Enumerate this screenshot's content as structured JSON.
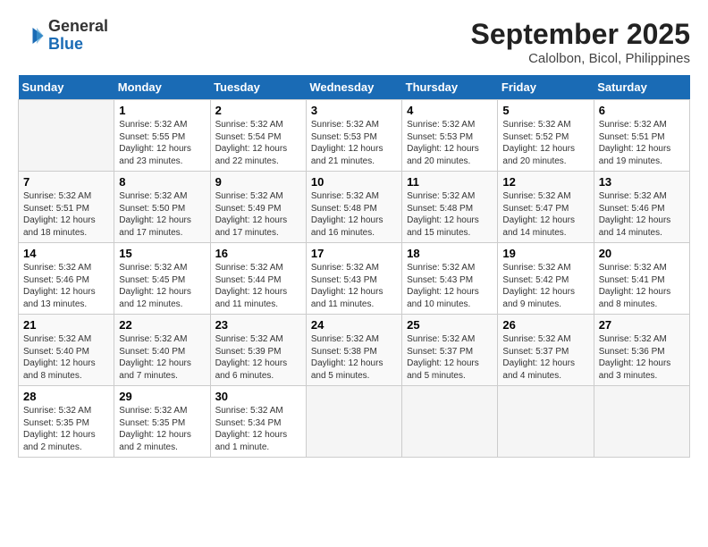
{
  "header": {
    "logo": {
      "general": "General",
      "blue": "Blue"
    },
    "month_year": "September 2025",
    "location": "Calolbon, Bicol, Philippines"
  },
  "weekdays": [
    "Sunday",
    "Monday",
    "Tuesday",
    "Wednesday",
    "Thursday",
    "Friday",
    "Saturday"
  ],
  "weeks": [
    [
      {
        "day": null
      },
      {
        "day": 1,
        "sunrise": "5:32 AM",
        "sunset": "5:55 PM",
        "daylight": "12 hours and 23 minutes."
      },
      {
        "day": 2,
        "sunrise": "5:32 AM",
        "sunset": "5:54 PM",
        "daylight": "12 hours and 22 minutes."
      },
      {
        "day": 3,
        "sunrise": "5:32 AM",
        "sunset": "5:53 PM",
        "daylight": "12 hours and 21 minutes."
      },
      {
        "day": 4,
        "sunrise": "5:32 AM",
        "sunset": "5:53 PM",
        "daylight": "12 hours and 20 minutes."
      },
      {
        "day": 5,
        "sunrise": "5:32 AM",
        "sunset": "5:52 PM",
        "daylight": "12 hours and 20 minutes."
      },
      {
        "day": 6,
        "sunrise": "5:32 AM",
        "sunset": "5:51 PM",
        "daylight": "12 hours and 19 minutes."
      }
    ],
    [
      {
        "day": 7,
        "sunrise": "5:32 AM",
        "sunset": "5:51 PM",
        "daylight": "12 hours and 18 minutes."
      },
      {
        "day": 8,
        "sunrise": "5:32 AM",
        "sunset": "5:50 PM",
        "daylight": "12 hours and 17 minutes."
      },
      {
        "day": 9,
        "sunrise": "5:32 AM",
        "sunset": "5:49 PM",
        "daylight": "12 hours and 17 minutes."
      },
      {
        "day": 10,
        "sunrise": "5:32 AM",
        "sunset": "5:48 PM",
        "daylight": "12 hours and 16 minutes."
      },
      {
        "day": 11,
        "sunrise": "5:32 AM",
        "sunset": "5:48 PM",
        "daylight": "12 hours and 15 minutes."
      },
      {
        "day": 12,
        "sunrise": "5:32 AM",
        "sunset": "5:47 PM",
        "daylight": "12 hours and 14 minutes."
      },
      {
        "day": 13,
        "sunrise": "5:32 AM",
        "sunset": "5:46 PM",
        "daylight": "12 hours and 14 minutes."
      }
    ],
    [
      {
        "day": 14,
        "sunrise": "5:32 AM",
        "sunset": "5:46 PM",
        "daylight": "12 hours and 13 minutes."
      },
      {
        "day": 15,
        "sunrise": "5:32 AM",
        "sunset": "5:45 PM",
        "daylight": "12 hours and 12 minutes."
      },
      {
        "day": 16,
        "sunrise": "5:32 AM",
        "sunset": "5:44 PM",
        "daylight": "12 hours and 11 minutes."
      },
      {
        "day": 17,
        "sunrise": "5:32 AM",
        "sunset": "5:43 PM",
        "daylight": "12 hours and 11 minutes."
      },
      {
        "day": 18,
        "sunrise": "5:32 AM",
        "sunset": "5:43 PM",
        "daylight": "12 hours and 10 minutes."
      },
      {
        "day": 19,
        "sunrise": "5:32 AM",
        "sunset": "5:42 PM",
        "daylight": "12 hours and 9 minutes."
      },
      {
        "day": 20,
        "sunrise": "5:32 AM",
        "sunset": "5:41 PM",
        "daylight": "12 hours and 8 minutes."
      }
    ],
    [
      {
        "day": 21,
        "sunrise": "5:32 AM",
        "sunset": "5:40 PM",
        "daylight": "12 hours and 8 minutes."
      },
      {
        "day": 22,
        "sunrise": "5:32 AM",
        "sunset": "5:40 PM",
        "daylight": "12 hours and 7 minutes."
      },
      {
        "day": 23,
        "sunrise": "5:32 AM",
        "sunset": "5:39 PM",
        "daylight": "12 hours and 6 minutes."
      },
      {
        "day": 24,
        "sunrise": "5:32 AM",
        "sunset": "5:38 PM",
        "daylight": "12 hours and 5 minutes."
      },
      {
        "day": 25,
        "sunrise": "5:32 AM",
        "sunset": "5:37 PM",
        "daylight": "12 hours and 5 minutes."
      },
      {
        "day": 26,
        "sunrise": "5:32 AM",
        "sunset": "5:37 PM",
        "daylight": "12 hours and 4 minutes."
      },
      {
        "day": 27,
        "sunrise": "5:32 AM",
        "sunset": "5:36 PM",
        "daylight": "12 hours and 3 minutes."
      }
    ],
    [
      {
        "day": 28,
        "sunrise": "5:32 AM",
        "sunset": "5:35 PM",
        "daylight": "12 hours and 2 minutes."
      },
      {
        "day": 29,
        "sunrise": "5:32 AM",
        "sunset": "5:35 PM",
        "daylight": "12 hours and 2 minutes."
      },
      {
        "day": 30,
        "sunrise": "5:32 AM",
        "sunset": "5:34 PM",
        "daylight": "12 hours and 1 minute."
      },
      {
        "day": null
      },
      {
        "day": null
      },
      {
        "day": null
      },
      {
        "day": null
      }
    ]
  ],
  "labels": {
    "sunrise": "Sunrise:",
    "sunset": "Sunset:",
    "daylight": "Daylight:"
  }
}
